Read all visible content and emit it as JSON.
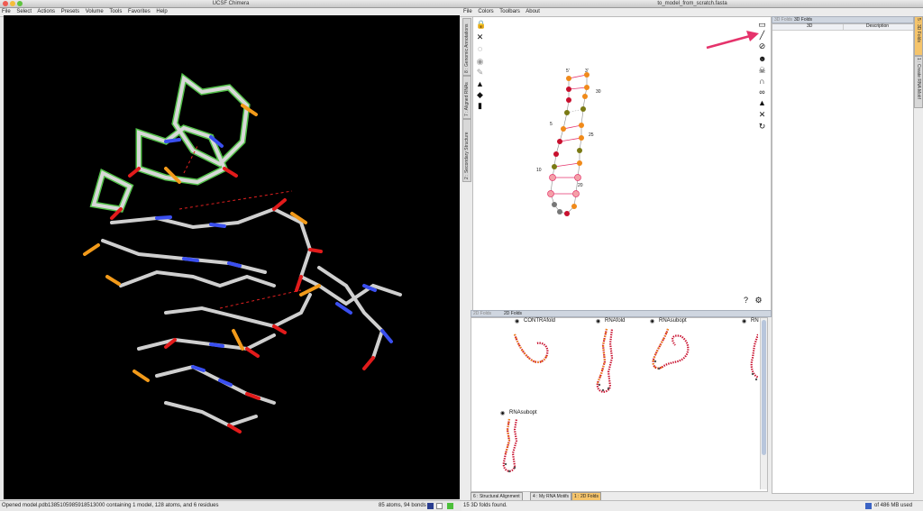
{
  "chimera": {
    "title": "UCSF Chimera",
    "menu": [
      "File",
      "Select",
      "Actions",
      "Presets",
      "Volume",
      "Tools",
      "Favorites",
      "Help"
    ],
    "status_left": "Opened model.pdb1385105985918513000 containing 1 model, 128 atoms, and 6 residues",
    "status_right": "85 atoms, 94 bonds"
  },
  "rna_app": {
    "title": "to_model_from_scratch.fasta",
    "menu": [
      "File",
      "Colors",
      "Toolbars",
      "About"
    ],
    "left_tabs": [
      "8 : Genomic Annotations",
      "7 : Aligned RNAs",
      "2 : Secondary Structure"
    ],
    "right_tabs": [
      "5 : 3D Folds",
      "1 : Create RNA Motif"
    ],
    "structure_labels": {
      "five_prime": "5'",
      "three_prime": "3'",
      "n30": "30",
      "n5": "5",
      "n25": "25",
      "n10": "10",
      "n20": "20"
    },
    "panel_2d_title": "2D Folds",
    "panel_2d_close": "2D Folds",
    "folds": [
      {
        "name": "CONTRAfold"
      },
      {
        "name": "RNAfold"
      },
      {
        "name": "RNAsubopt"
      },
      {
        "name": "RN"
      },
      {
        "name": "RNAsubopt"
      }
    ],
    "bottom_tabs": [
      "6 : Structural Alignment",
      "4 : My RNA Motifs",
      "1 : 2D Folds"
    ],
    "folds3d": {
      "tab_label": "3D Folds",
      "tab_close": "3D Folds",
      "col_3d": "3D",
      "col_desc": "Description"
    },
    "status_left": "15 3D folds found.",
    "status_right": "of 486 MB used",
    "colors": {
      "accent": "#e5336b",
      "orange": "#f08a1a",
      "red": "#c8102e",
      "olive": "#7a7a14",
      "grey": "#777777"
    }
  }
}
